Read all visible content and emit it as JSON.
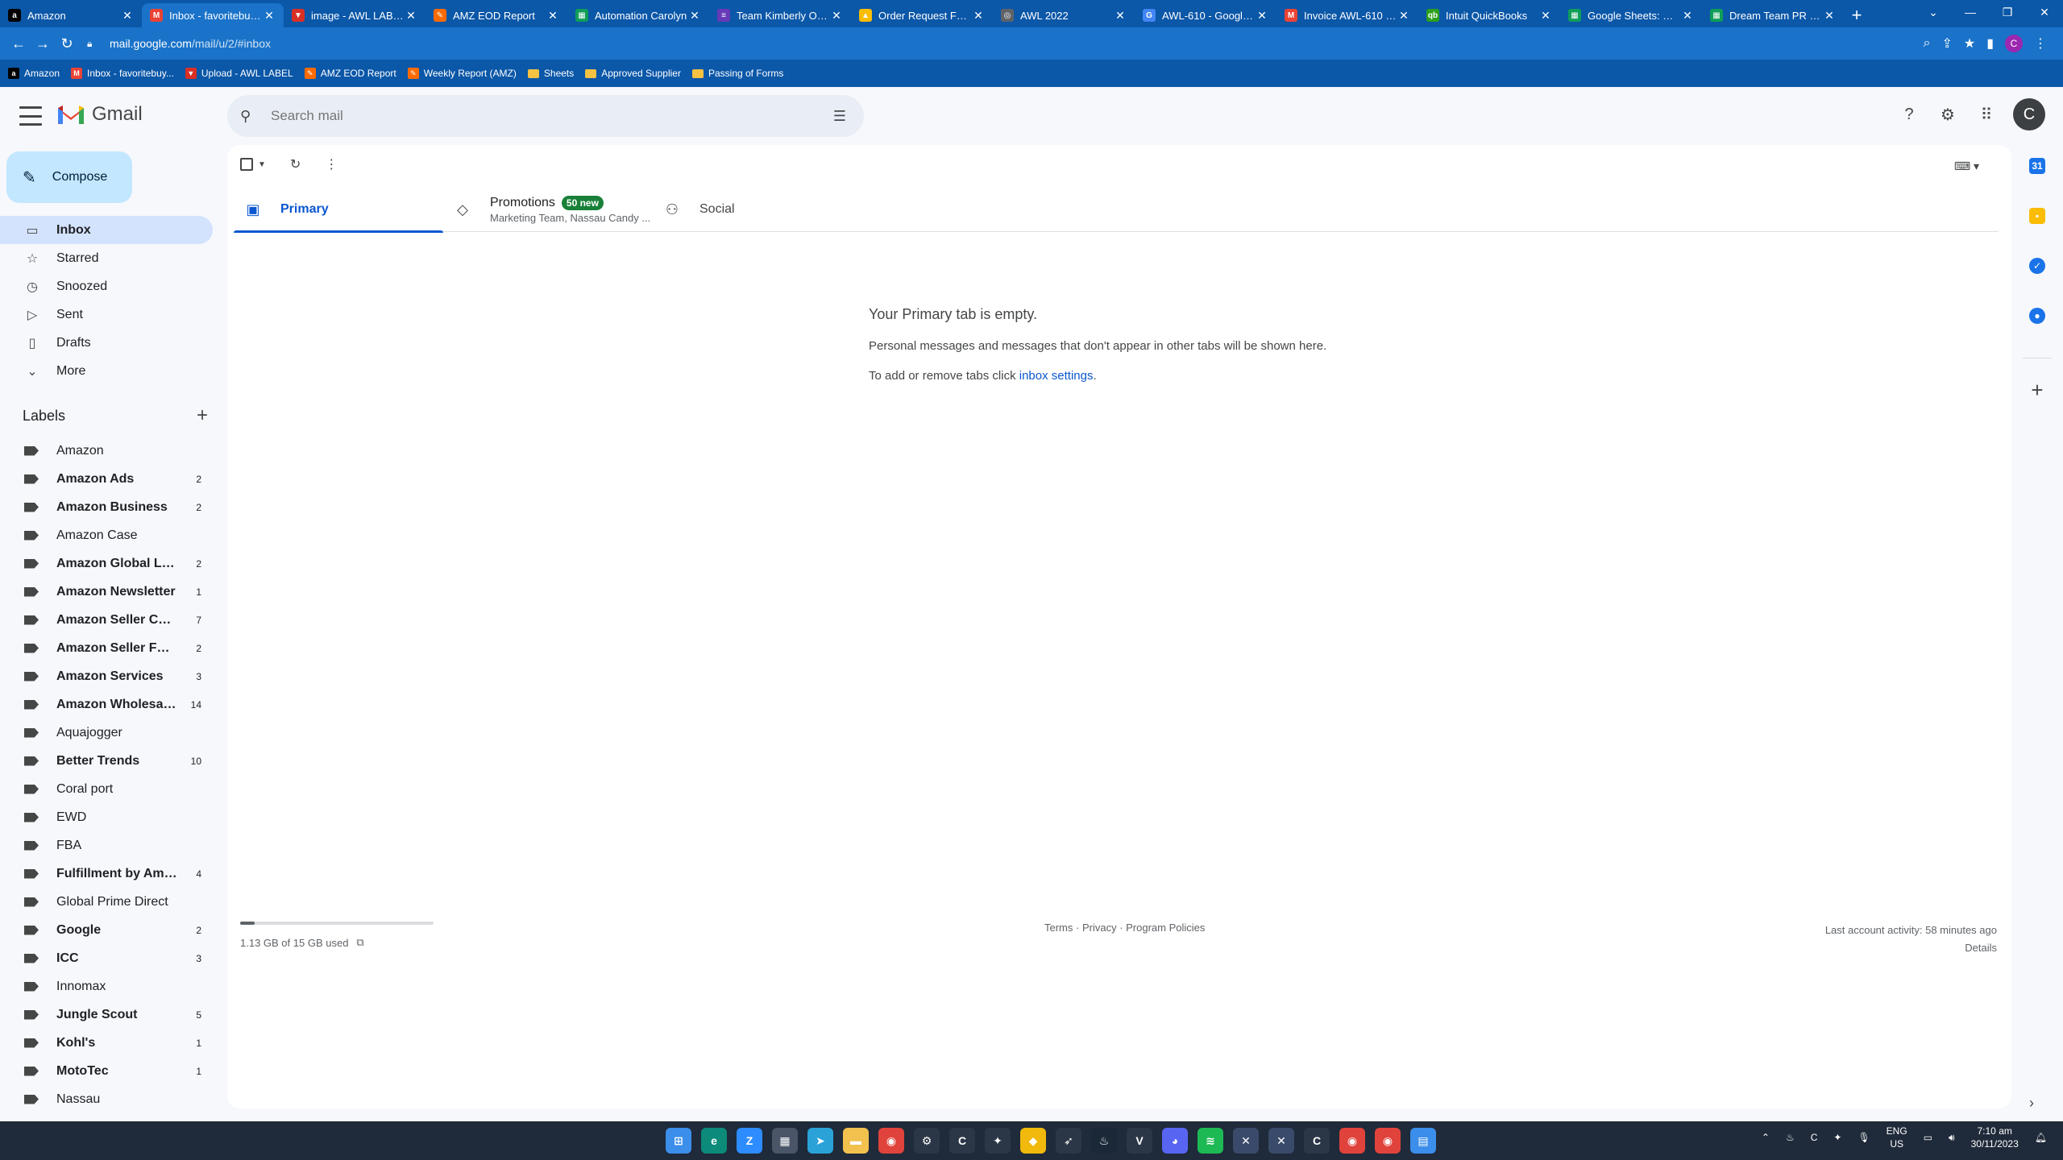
{
  "browser": {
    "tabs": [
      {
        "title": "Amazon",
        "icon": "amazon-icon",
        "color": "#000000",
        "glyph": "a"
      },
      {
        "title": "Inbox - favoritebuys...",
        "icon": "gmail-icon",
        "color": "#ea4335",
        "glyph": "M",
        "active": true
      },
      {
        "title": "image - AWL LABEL",
        "icon": "label-icon",
        "color": "#d93025",
        "glyph": "▼"
      },
      {
        "title": "AMZ EOD Report",
        "icon": "zapier-icon",
        "color": "#ff6b00",
        "glyph": "✎"
      },
      {
        "title": "Automation Carolyn",
        "icon": "sheets-icon",
        "color": "#0f9d58",
        "glyph": "▦"
      },
      {
        "title": "Team Kimberly Orde",
        "icon": "forms-icon",
        "color": "#673ab7",
        "glyph": "≡"
      },
      {
        "title": "Order Request Form",
        "icon": "drive-icon",
        "color": "#fbbc04",
        "glyph": "▲"
      },
      {
        "title": "AWL 2022",
        "icon": "globe-icon",
        "color": "#5f6368",
        "glyph": "◎"
      },
      {
        "title": "AWL-610 - Google S",
        "icon": "google-icon",
        "color": "#4285f4",
        "glyph": "G"
      },
      {
        "title": "Invoice AWL-610 fro",
        "icon": "gmail-icon",
        "color": "#ea4335",
        "glyph": "M"
      },
      {
        "title": "Intuit QuickBooks",
        "icon": "quickbooks-icon",
        "color": "#2ca01c",
        "glyph": "qb"
      },
      {
        "title": "Google Sheets: Onli",
        "icon": "sheets-icon",
        "color": "#0f9d58",
        "glyph": "▦"
      },
      {
        "title": "Dream Team PR SHI",
        "icon": "sheets-icon",
        "color": "#0f9d58",
        "glyph": "▦"
      }
    ],
    "url_host": "mail.google.com",
    "url_path": "/mail/u/2/#inbox",
    "profile_initial": "C",
    "bookmarks": [
      {
        "label": "Amazon",
        "icon": "amazon-icon",
        "type": "icon",
        "color": "#000000",
        "glyph": "a"
      },
      {
        "label": "Inbox - favoritebuy...",
        "icon": "gmail-icon",
        "type": "icon",
        "color": "#ea4335",
        "glyph": "M"
      },
      {
        "label": "Upload - AWL LABEL",
        "icon": "label-icon",
        "type": "icon",
        "color": "#d93025",
        "glyph": "▼"
      },
      {
        "label": "AMZ EOD Report",
        "icon": "zapier-icon",
        "type": "icon",
        "color": "#ff6b00",
        "glyph": "✎"
      },
      {
        "label": "Weekly Report (AMZ)",
        "icon": "zapier-icon",
        "type": "icon",
        "color": "#ff6b00",
        "glyph": "✎"
      },
      {
        "label": "Sheets",
        "icon": "folder-icon",
        "type": "folder"
      },
      {
        "label": "Approved Supplier",
        "icon": "folder-icon",
        "type": "folder"
      },
      {
        "label": "Passing of Forms",
        "icon": "folder-icon",
        "type": "folder"
      }
    ]
  },
  "gmail": {
    "app_name": "Gmail",
    "search_placeholder": "Search mail",
    "avatar_initial": "C",
    "compose_label": "Compose",
    "nav": [
      {
        "label": "Inbox",
        "icon": "inbox-icon",
        "glyph": "▭",
        "active": true
      },
      {
        "label": "Starred",
        "icon": "star-icon",
        "glyph": "☆"
      },
      {
        "label": "Snoozed",
        "icon": "clock-icon",
        "glyph": "◷"
      },
      {
        "label": "Sent",
        "icon": "send-icon",
        "glyph": "▷"
      },
      {
        "label": "Drafts",
        "icon": "draft-icon",
        "glyph": "▯"
      },
      {
        "label": "More",
        "icon": "chevron-down-icon",
        "glyph": "⌄"
      }
    ],
    "labels_heading": "Labels",
    "labels": [
      {
        "name": "Amazon",
        "count": "",
        "bold": false
      },
      {
        "name": "Amazon Ads",
        "count": "2",
        "bold": true
      },
      {
        "name": "Amazon Business",
        "count": "2",
        "bold": true
      },
      {
        "name": "Amazon Case",
        "count": "",
        "bold": false
      },
      {
        "name": "Amazon Global Lo...",
        "count": "2",
        "bold": true
      },
      {
        "name": "Amazon Newsletter",
        "count": "1",
        "bold": true
      },
      {
        "name": "Amazon Seller Cen...",
        "count": "7",
        "bold": true
      },
      {
        "name": "Amazon Seller Foru...",
        "count": "2",
        "bold": true
      },
      {
        "name": "Amazon Services",
        "count": "3",
        "bold": true
      },
      {
        "name": "Amazon Wholesales",
        "count": "14",
        "bold": true
      },
      {
        "name": "Aquajogger",
        "count": "",
        "bold": false
      },
      {
        "name": "Better Trends",
        "count": "10",
        "bold": true
      },
      {
        "name": "Coral port",
        "count": "",
        "bold": false
      },
      {
        "name": "EWD",
        "count": "",
        "bold": false
      },
      {
        "name": "FBA",
        "count": "",
        "bold": false
      },
      {
        "name": "Fulfillment by Ama...",
        "count": "4",
        "bold": true
      },
      {
        "name": "Global Prime Direct",
        "count": "",
        "bold": false
      },
      {
        "name": "Google",
        "count": "2",
        "bold": true
      },
      {
        "name": "ICC",
        "count": "3",
        "bold": true
      },
      {
        "name": "Innomax",
        "count": "",
        "bold": false
      },
      {
        "name": "Jungle Scout",
        "count": "5",
        "bold": true
      },
      {
        "name": "Kohl's",
        "count": "1",
        "bold": true
      },
      {
        "name": "MotoTec",
        "count": "1",
        "bold": true
      },
      {
        "name": "Nassau",
        "count": "",
        "bold": false
      }
    ],
    "tabs": {
      "primary": "Primary",
      "promotions": "Promotions",
      "promotions_badge": "50 new",
      "promotions_sub": "Marketing Team, Nassau Candy ...",
      "social": "Social"
    },
    "empty": {
      "title": "Your Primary tab is empty.",
      "line1": "Personal messages and messages that don't appear in other tabs will be shown here.",
      "line2_prefix": "To add or remove tabs click ",
      "line2_link": "inbox settings",
      "line2_suffix": "."
    },
    "footer": {
      "storage": "1.13 GB of 15 GB used",
      "storage_fraction": 0.075,
      "terms": "Terms",
      "privacy": "Privacy",
      "policies": "Program Policies",
      "sep": " · ",
      "activity": "Last account activity: 58 minutes ago",
      "details": "Details"
    }
  },
  "taskbar": {
    "apps": [
      {
        "name": "start",
        "color": "#3b8eea",
        "glyph": "⊞"
      },
      {
        "name": "edge",
        "color": "#0c8a7a",
        "glyph": "e"
      },
      {
        "name": "zoom",
        "color": "#2d8cff",
        "glyph": "Z"
      },
      {
        "name": "calculator",
        "color": "#4a5568",
        "glyph": "▦"
      },
      {
        "name": "telegram",
        "color": "#2aa2d8",
        "glyph": "➤"
      },
      {
        "name": "files",
        "color": "#f2c14e",
        "glyph": "▬"
      },
      {
        "name": "chrome",
        "color": "#e0433b",
        "glyph": "◉"
      },
      {
        "name": "settings",
        "color": "#2b3646",
        "glyph": "⚙"
      },
      {
        "name": "app-c",
        "color": "#2b3646",
        "glyph": "C"
      },
      {
        "name": "app-star",
        "color": "#2b3646",
        "glyph": "✦"
      },
      {
        "name": "binance",
        "color": "#f0b90b",
        "glyph": "◆"
      },
      {
        "name": "app-bird",
        "color": "#2b3646",
        "glyph": "➶"
      },
      {
        "name": "steam",
        "color": "#1b2838",
        "glyph": "♨"
      },
      {
        "name": "app-v",
        "color": "#2b3646",
        "glyph": "V"
      },
      {
        "name": "discord",
        "color": "#5865f2",
        "glyph": "◕"
      },
      {
        "name": "spotify",
        "color": "#1db954",
        "glyph": "≋"
      },
      {
        "name": "app-x1",
        "color": "#3a4a6a",
        "glyph": "✕"
      },
      {
        "name": "app-x2",
        "color": "#3a4a6a",
        "glyph": "✕"
      },
      {
        "name": "app-c2",
        "color": "#2b3646",
        "glyph": "C"
      },
      {
        "name": "chrome-2",
        "color": "#e0433b",
        "glyph": "◉"
      },
      {
        "name": "chrome-3",
        "color": "#e0433b",
        "glyph": "◉"
      },
      {
        "name": "notepad",
        "color": "#3b8eea",
        "glyph": "▤"
      }
    ],
    "lang_top": "ENG",
    "lang_bottom": "US",
    "time": "7:10 am",
    "date": "30/11/2023"
  }
}
